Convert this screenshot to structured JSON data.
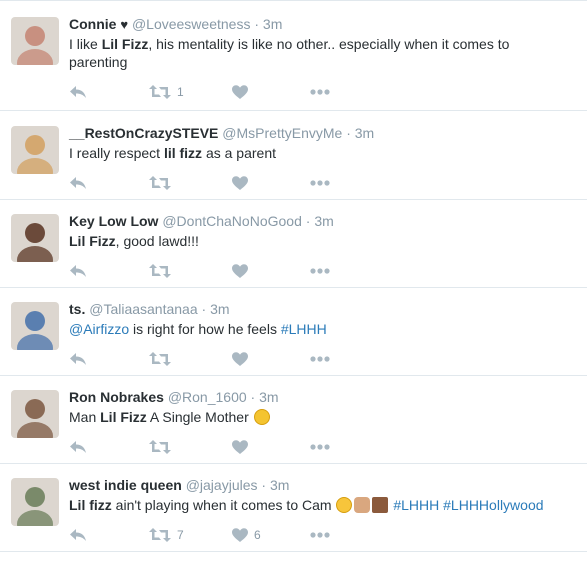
{
  "tweets": [
    {
      "fullname": "Connie",
      "has_heart_glyph": true,
      "heart_glyph": "♥",
      "screen_name": "@Loveesweetness",
      "sep": "·",
      "time": "3m",
      "text_parts": [
        {
          "t": "I like ",
          "b": false
        },
        {
          "t": "Lil Fizz",
          "b": true
        },
        {
          "t": ", his mentality is like no other.. especially when it comes to",
          "b": false
        }
      ],
      "text_line2": "parenting",
      "retweet_count": "1",
      "like_count": "",
      "avatar_color": "#c89080"
    },
    {
      "fullname": "__RestOnCrazySTEVE",
      "screen_name": "@MsPrettyEnvyMe",
      "sep": "·",
      "time": "3m",
      "text_parts": [
        {
          "t": "I really respect ",
          "b": false
        },
        {
          "t": "lil fizz",
          "b": true
        },
        {
          "t": " as a parent",
          "b": false
        }
      ],
      "retweet_count": "",
      "like_count": "",
      "avatar_color": "#d4a870"
    },
    {
      "fullname": "Key Low Low",
      "screen_name": "@DontChaNoNoGood",
      "sep": "·",
      "time": "3m",
      "text_parts": [
        {
          "t": "Lil Fizz",
          "b": true
        },
        {
          "t": ", good lawd!!!",
          "b": false
        }
      ],
      "retweet_count": "",
      "like_count": "",
      "avatar_color": "#6b4a3a"
    },
    {
      "fullname": "ts.",
      "screen_name": "@Taliaasantanaa",
      "sep": "·",
      "time": "3m",
      "text_parts": [
        {
          "t": "@Airfizzo",
          "b": false,
          "link": true
        },
        {
          "t": " is right for how he feels ",
          "b": false
        },
        {
          "t": "#LHHH",
          "b": false,
          "link": true
        }
      ],
      "retweet_count": "",
      "like_count": "",
      "avatar_color": "#5a7fb0"
    },
    {
      "fullname": "Ron Nobrakes",
      "screen_name": "@Ron_1600",
      "sep": "·",
      "time": "3m",
      "text_parts": [
        {
          "t": "Man ",
          "b": false
        },
        {
          "t": "Lil Fizz",
          "b": true
        },
        {
          "t": " A Single Mother ",
          "b": false
        }
      ],
      "emoji": [
        "weary"
      ],
      "retweet_count": "",
      "like_count": "",
      "avatar_color": "#8a6a55"
    },
    {
      "fullname": "west indie queen",
      "screen_name": "@jajayjules",
      "sep": "·",
      "time": "3m",
      "text_parts": [
        {
          "t": "Lil fizz",
          "b": true
        },
        {
          "t": " ain't playing when it comes to Cam ",
          "b": false
        }
      ],
      "emoji": [
        "joy",
        "hands",
        "square"
      ],
      "text_after_emoji": [
        {
          "t": " #LHHH",
          "link": true
        },
        {
          "t": " #LHHHollywood",
          "link": true
        }
      ],
      "retweet_count": "7",
      "like_count": "6",
      "avatar_color": "#7a8a6a"
    }
  ],
  "icons": {
    "reply": "reply-icon",
    "retweet": "retweet-icon",
    "like": "heart-icon",
    "more": "more-icon"
  },
  "colors": {
    "text": "#292f33",
    "muted": "#8899a6",
    "icon": "#aab8c2",
    "link": "#2b7bb9",
    "border": "#e1e8ed"
  }
}
